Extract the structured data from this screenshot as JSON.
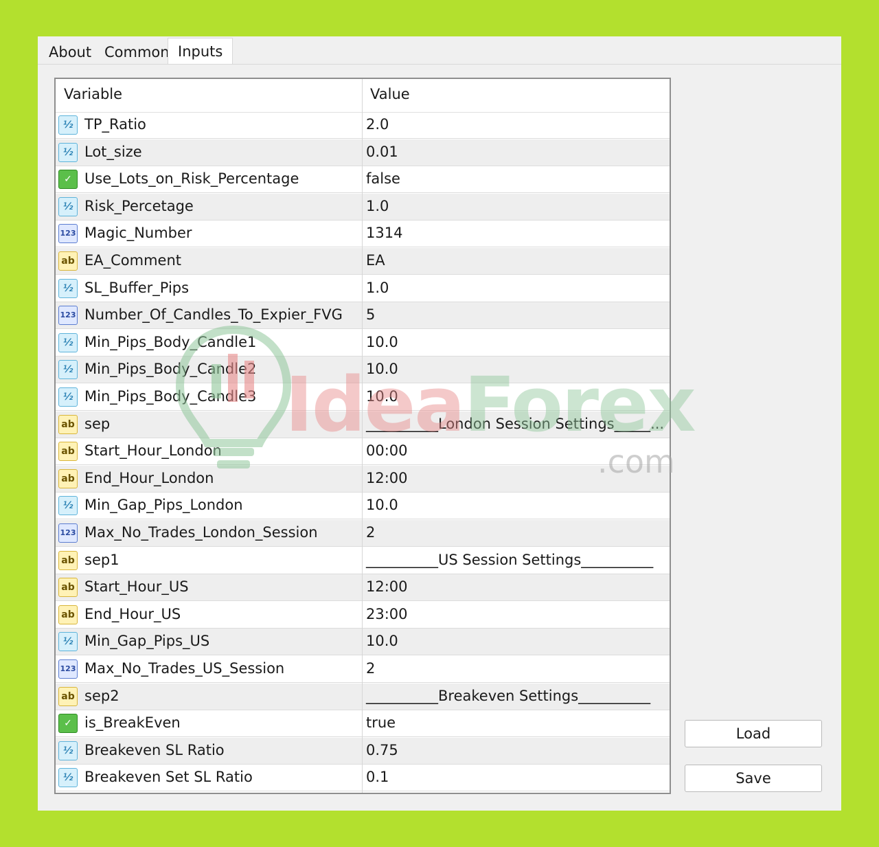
{
  "tabs": [
    "About",
    "Common",
    "Inputs"
  ],
  "active_tab": "Inputs",
  "table": {
    "headers": {
      "variable": "Variable",
      "value": "Value"
    },
    "rows": [
      {
        "type": "real-icon",
        "name": "TP_Ratio",
        "value": "2.0"
      },
      {
        "type": "real-icon",
        "name": "Lot_size",
        "value": "0.01"
      },
      {
        "type": "bool-icon",
        "name": "Use_Lots_on_Risk_Percentage",
        "value": "false"
      },
      {
        "type": "real-icon",
        "name": "Risk_Percetage",
        "value": "1.0"
      },
      {
        "type": "int-icon",
        "name": "Magic_Number",
        "value": "1314"
      },
      {
        "type": "string-icon",
        "name": "EA_Comment",
        "value": "EA"
      },
      {
        "type": "real-icon",
        "name": "SL_Buffer_Pips",
        "value": "1.0"
      },
      {
        "type": "int-icon",
        "name": "Number_Of_Candles_To_Expier_FVG",
        "value": "5"
      },
      {
        "type": "real-icon",
        "name": "Min_Pips_Body_Candle1",
        "value": "10.0"
      },
      {
        "type": "real-icon",
        "name": "Min_Pips_Body_Candle2",
        "value": "10.0"
      },
      {
        "type": "real-icon",
        "name": "Min_Pips_Body_Candle3",
        "value": "10.0"
      },
      {
        "type": "string-icon",
        "name": "sep",
        "value": "__________London Session Settings_____..."
      },
      {
        "type": "string-icon",
        "name": "Start_Hour_London",
        "value": "00:00"
      },
      {
        "type": "string-icon",
        "name": "End_Hour_London",
        "value": "12:00"
      },
      {
        "type": "real-icon",
        "name": "Min_Gap_Pips_London",
        "value": "10.0"
      },
      {
        "type": "int-icon",
        "name": "Max_No_Trades_London_Session",
        "value": "2"
      },
      {
        "type": "string-icon",
        "name": "sep1",
        "value": "__________US Session Settings__________"
      },
      {
        "type": "string-icon",
        "name": "Start_Hour_US",
        "value": "12:00"
      },
      {
        "type": "string-icon",
        "name": "End_Hour_US",
        "value": "23:00"
      },
      {
        "type": "real-icon",
        "name": "Min_Gap_Pips_US",
        "value": "10.0"
      },
      {
        "type": "int-icon",
        "name": "Max_No_Trades_US_Session",
        "value": "2"
      },
      {
        "type": "string-icon",
        "name": "sep2",
        "value": "__________Breakeven Settings__________"
      },
      {
        "type": "bool-icon",
        "name": "is_BreakEven",
        "value": "true"
      },
      {
        "type": "real-icon",
        "name": "Breakeven SL Ratio",
        "value": "0.75"
      },
      {
        "type": "real-icon",
        "name": "Breakeven Set SL Ratio",
        "value": "0.1"
      }
    ]
  },
  "icon_glyphs": {
    "real-icon": "½",
    "bool-icon": "✓",
    "int-icon": "123",
    "string-icon": "ab"
  },
  "buttons": {
    "load": "Load",
    "save": "Save"
  },
  "watermark": {
    "brand_a": "Idea",
    "brand_b": "Forex",
    "suffix": ".com"
  },
  "colors": {
    "background": "#b3e02e",
    "row_alt": "#eeeeee",
    "watermark_red": "#e88a8a",
    "watermark_green": "#8fc79a"
  }
}
